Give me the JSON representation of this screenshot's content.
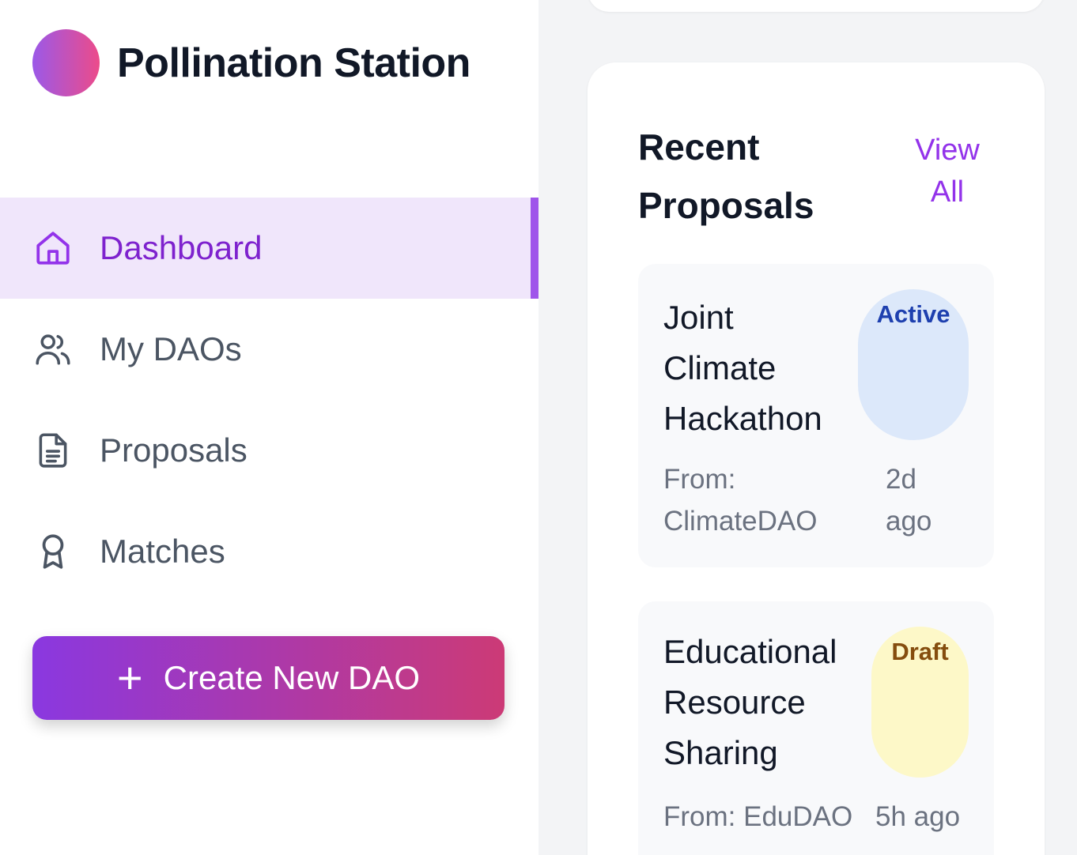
{
  "brand": {
    "name": "Pollination Station"
  },
  "nav": {
    "items": [
      {
        "label": "Dashboard",
        "icon": "home-icon",
        "active": true
      },
      {
        "label": "My DAOs",
        "icon": "users-icon",
        "active": false
      },
      {
        "label": "Proposals",
        "icon": "document-icon",
        "active": false
      },
      {
        "label": "Matches",
        "icon": "award-icon",
        "active": false
      }
    ]
  },
  "create_button": {
    "label": "Create New DAO",
    "icon": "plus-icon"
  },
  "recent": {
    "title": "Recent Proposals",
    "view_all": "View All",
    "proposals": [
      {
        "title": "Joint Climate Hackathon",
        "status": "Active",
        "from": "From: ClimateDAO",
        "time": "2d ago"
      },
      {
        "title": "Educational Resource Sharing",
        "status": "Draft",
        "from": "From: EduDAO",
        "time": "5h ago"
      }
    ]
  },
  "colors": {
    "accent": "#9333ea",
    "active_badge_bg": "#dce8fa",
    "active_badge_text": "#1e40af",
    "draft_badge_bg": "#fdf8c8",
    "draft_badge_text": "#854d0e"
  }
}
